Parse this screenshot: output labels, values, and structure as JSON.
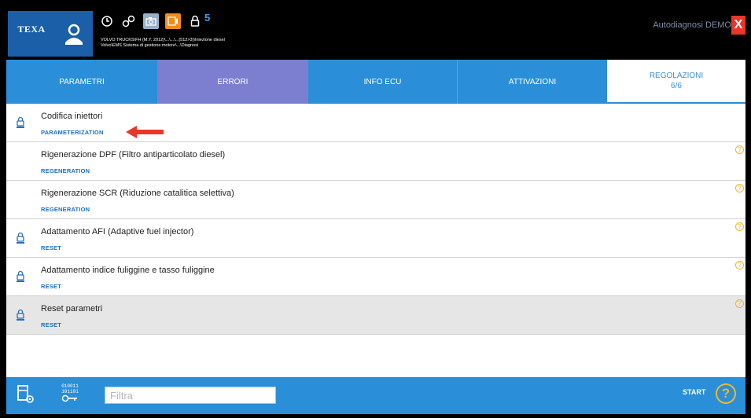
{
  "header": {
    "logo": "TEXA",
    "badge_count": "5",
    "vehicle_line1": "VOLVO TRUCKS\\FH (M.Y. 2012)\\...\\...\\...(512>3)\\Iniezione diesel",
    "vehicle_line2": "Volvo\\EMS Sistema di gestione motore\\...\\Diagnosi",
    "mode": "Autodiagnosi DEMO",
    "close_label": "X"
  },
  "tabs": [
    {
      "label": "PARAMETRI",
      "sub": ""
    },
    {
      "label": "ERRORI",
      "sub": ""
    },
    {
      "label": "INFO ECU",
      "sub": ""
    },
    {
      "label": "ATTIVAZIONI",
      "sub": ""
    },
    {
      "label": "REGOLAZIONI",
      "sub": "6/6"
    }
  ],
  "rows": [
    {
      "title": "Codifica iniettori",
      "category": "PARAMETERIZATION",
      "locked": true,
      "help": false
    },
    {
      "title": "Rigenerazione DPF (Filtro antiparticolato diesel)",
      "category": "REGENERATION",
      "locked": false,
      "help": true
    },
    {
      "title": "Rigenerazione SCR (Riduzione catalitica selettiva)",
      "category": "REGENERATION",
      "locked": false,
      "help": true
    },
    {
      "title": "Adattamento AFI (Adaptive fuel injector)",
      "category": "RESET",
      "locked": true,
      "help": true
    },
    {
      "title": "Adattamento indice fuliggine e tasso fuliggine",
      "category": "RESET",
      "locked": true,
      "help": true
    },
    {
      "title": "Reset parametri",
      "category": "RESET",
      "locked": true,
      "help": true,
      "selected": true
    }
  ],
  "help_glyph": "?",
  "footer": {
    "binary_top": "010011",
    "binary_bottom": "101101",
    "filter_placeholder": "Filtra",
    "start_label": "START",
    "help_label": "?"
  },
  "colors": {
    "tab_blue": "#2a8fd8",
    "tab_active_errors": "#7c7fd0",
    "category_blue": "#1a6fc2",
    "help_yellow": "#f0b429",
    "close_red": "#e8362b",
    "annotation_arrow": "#e8362b"
  }
}
